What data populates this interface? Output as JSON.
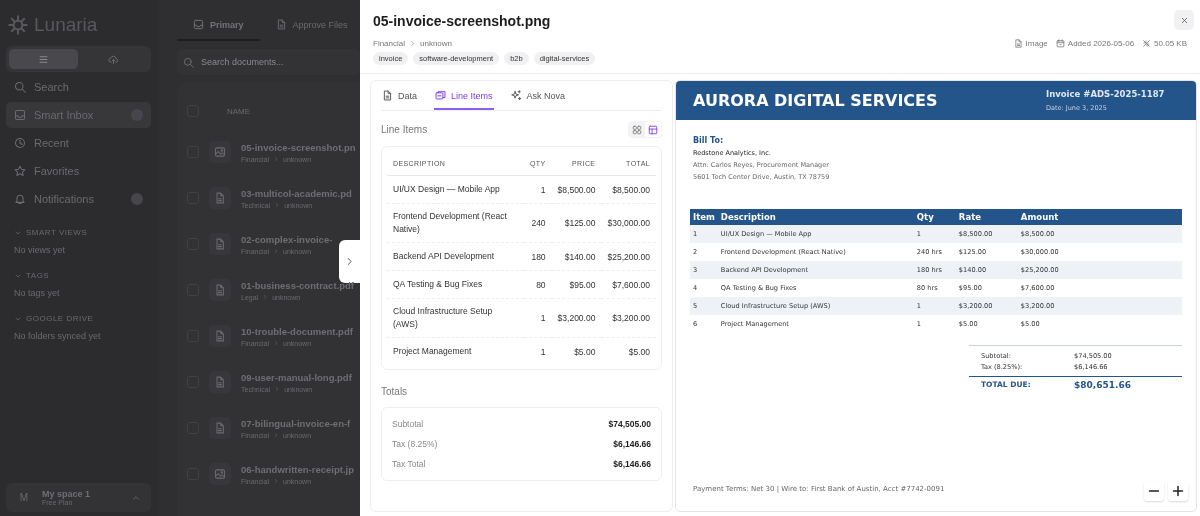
{
  "sidebar": {
    "logo": "Lunaria",
    "view_switch": [
      {
        "kind": "menu",
        "selected": true
      },
      {
        "kind": "upload",
        "selected": false
      }
    ],
    "nav": [
      {
        "kind": "search",
        "label": "Search",
        "selected": false,
        "badge": false
      },
      {
        "kind": "inbox",
        "label": "Smart Inbox",
        "selected": true,
        "badge": true
      },
      {
        "kind": "clock",
        "label": "Recent",
        "selected": false,
        "badge": false
      },
      {
        "kind": "star",
        "label": "Favorites",
        "selected": false,
        "badge": false
      },
      {
        "kind": "bell",
        "label": "Notifications",
        "selected": false,
        "badge": true
      }
    ],
    "sections": [
      {
        "title": "SMART VIEWS",
        "empty": "No views yet"
      },
      {
        "title": "TAGS",
        "empty": "No tags yet"
      },
      {
        "title": "GOOGLE DRIVE",
        "empty": "No folders synced yet"
      }
    ],
    "space": {
      "initial": "M",
      "name": "My space 1",
      "plan": "Free Plan"
    }
  },
  "documents": {
    "tabs": [
      {
        "kind": "inbox",
        "label": "Primary",
        "selected": true
      },
      {
        "kind": "file",
        "label": "Approve Files",
        "selected": false
      }
    ],
    "search": {
      "placeholder": "Search documents..."
    },
    "column": "NAME",
    "select_all": {
      "checked": false
    },
    "rows": [
      {
        "kind": "image",
        "name": "05-invoice-screenshot.pn",
        "category": "Financial",
        "status": "unknown",
        "checked": false
      },
      {
        "kind": "doc",
        "name": "03-multicol-academic.pd",
        "category": "Technical",
        "status": "unknown",
        "checked": false
      },
      {
        "kind": "doc",
        "name": "02-complex-invoice-",
        "category": "Financial",
        "status": "unknown",
        "checked": false
      },
      {
        "kind": "doc",
        "name": "01-business-contract.pdf",
        "category": "Legal",
        "status": "unknown",
        "checked": false
      },
      {
        "kind": "doc",
        "name": "10-trouble-document.pdf",
        "category": "Financial",
        "status": "unknown",
        "checked": false
      },
      {
        "kind": "doc",
        "name": "09-user-manual-long.pdf",
        "category": "Technical",
        "status": "unknown",
        "checked": false
      },
      {
        "kind": "doc",
        "name": "07-bilingual-invoice-en-f",
        "category": "Financial",
        "status": "unknown",
        "checked": false
      },
      {
        "kind": "image",
        "name": "06-handwritten-receipt.jp",
        "category": "Financial",
        "status": "unknown",
        "checked": false
      }
    ]
  },
  "detail": {
    "title": "05-invoice-screenshot.png",
    "breadcrumb": [
      "Financial",
      "unknown"
    ],
    "meta": [
      {
        "kind": "file",
        "text": "Image"
      },
      {
        "kind": "calendar",
        "text": "Added 2026-05-06"
      },
      {
        "kind": "size",
        "text": "50.05 KB"
      }
    ],
    "tags": [
      "invoice",
      "software-development",
      "b2b",
      "digital-services"
    ],
    "tabs": [
      {
        "kind": "file",
        "label": "Data",
        "selected": false
      },
      {
        "kind": "items",
        "label": "Line Items",
        "selected": true
      },
      {
        "kind": "sparkle",
        "label": "Ask Nova",
        "selected": false
      }
    ],
    "line_items": {
      "title": "Line Items",
      "view_toggle": [
        {
          "kind": "grid",
          "selected": false
        },
        {
          "kind": "table",
          "selected": true
        }
      ],
      "columns": [
        "DESCRIPTION",
        "QTY",
        "PRICE",
        "TOTAL"
      ],
      "rows": [
        [
          "UI/UX Design — Mobile App",
          "1",
          "$8,500.00",
          "$8,500.00"
        ],
        [
          "Frontend Development (React Native)",
          "240",
          "$125.00",
          "$30,000.00"
        ],
        [
          "Backend API Development",
          "180",
          "$140.00",
          "$25,200.00"
        ],
        [
          "QA Testing & Bug Fixes",
          "80",
          "$95.00",
          "$7,600.00"
        ],
        [
          "Cloud Infrastructure Setup (AWS)",
          "1",
          "$3,200.00",
          "$3,200.00"
        ],
        [
          "Project Management",
          "1",
          "$5.00",
          "$5.00"
        ]
      ]
    },
    "totals": {
      "title": "Totals",
      "rows": [
        {
          "label": "Subtotal",
          "value": "$74,505.00"
        },
        {
          "label": "Tax (8.25%)",
          "value": "$6,146.66"
        },
        {
          "label": "Tax Total",
          "value": "$6,146.66"
        }
      ]
    },
    "preview": {
      "company": "AURORA DIGITAL SERVICES",
      "invoice_no": "Invoice #ADS-2025-1187",
      "date": "Date: June 3, 2025",
      "bill_to": {
        "heading": "Bill To:",
        "name": "Redstone Analytics, Inc.",
        "lines": [
          "Attn: Carlos Reyes, Procurement Manager",
          "5601 Tech Center Drive, Austin, TX 78759"
        ]
      },
      "columns": [
        "Item",
        "Description",
        "Qty",
        "Rate",
        "Amount"
      ],
      "rows": [
        [
          "1",
          "UI/UX Design — Mobile App",
          "1",
          "$8,500.00",
          "$8,500.00"
        ],
        [
          "2",
          "Frontend Development (React Native)",
          "240 hrs",
          "$125.00",
          "$30,000.00"
        ],
        [
          "3",
          "Backend API Development",
          "180 hrs",
          "$140.00",
          "$25,200.00"
        ],
        [
          "4",
          "QA Testing & Bug Fixes",
          "80 hrs",
          "$95.00",
          "$7,600.00"
        ],
        [
          "5",
          "Cloud Infrastructure Setup (AWS)",
          "1",
          "$3,200.00",
          "$3,200.00"
        ],
        [
          "6",
          "Project Management",
          "1",
          "$5.00",
          "$5.00"
        ]
      ],
      "sums": [
        {
          "label": "Subtotal:",
          "value": "$74,505.00"
        },
        {
          "label": "Tax (8.25%):",
          "value": "$6,146.66"
        }
      ],
      "total_due": {
        "label": "TOTAL DUE:",
        "value": "$80,651.66"
      },
      "footer": "Payment Terms: Net 30 | Wire to: First Bank of Austin, Acct #7742-0091"
    }
  }
}
